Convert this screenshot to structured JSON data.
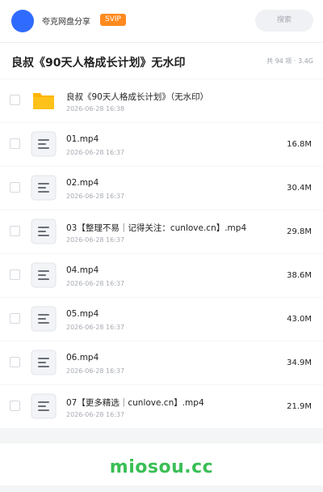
{
  "header": {
    "app_name": "夸克网盘分享",
    "vip_badge": "SVIP",
    "search_placeholder": "搜索"
  },
  "folder": {
    "title": "良叔《90天人格成长计划》无水印",
    "summary": "共 94 项 · 3.4G"
  },
  "files": [
    {
      "name": "良叔《90天人格成长计划》（无水印）",
      "date": "2026-06-28 16:38",
      "size": "",
      "icon": "folder-icon"
    },
    {
      "name": "01.mp4",
      "date": "2026-06-28 16:37",
      "size": "16.8M",
      "icon": "file-icon"
    },
    {
      "name": "02.mp4",
      "date": "2026-06-28 16:37",
      "size": "30.4M",
      "icon": "file-icon"
    },
    {
      "name": "03【整理不易｜记得关注：cunlove.cn】.mp4",
      "date": "2026-06-28 16:37",
      "size": "29.8M",
      "icon": "file-icon"
    },
    {
      "name": "04.mp4",
      "date": "2026-06-28 16:37",
      "size": "38.6M",
      "icon": "file-icon"
    },
    {
      "name": "05.mp4",
      "date": "2026-06-28 16:37",
      "size": "43.0M",
      "icon": "file-icon"
    },
    {
      "name": "06.mp4",
      "date": "2026-06-28 16:37",
      "size": "34.9M",
      "icon": "file-icon"
    },
    {
      "name": "07【更多精选｜cunlove.cn】.mp4",
      "date": "2026-06-28 16:37",
      "size": "21.9M",
      "icon": "file-icon"
    }
  ],
  "footer": {
    "watermark": "miosou.cc"
  },
  "colors": {
    "accent_blue": "#2f6bff",
    "vip_orange": "#ff8a1f",
    "folder_yellow": "#ffc21a",
    "watermark_green": "#39bf55"
  }
}
